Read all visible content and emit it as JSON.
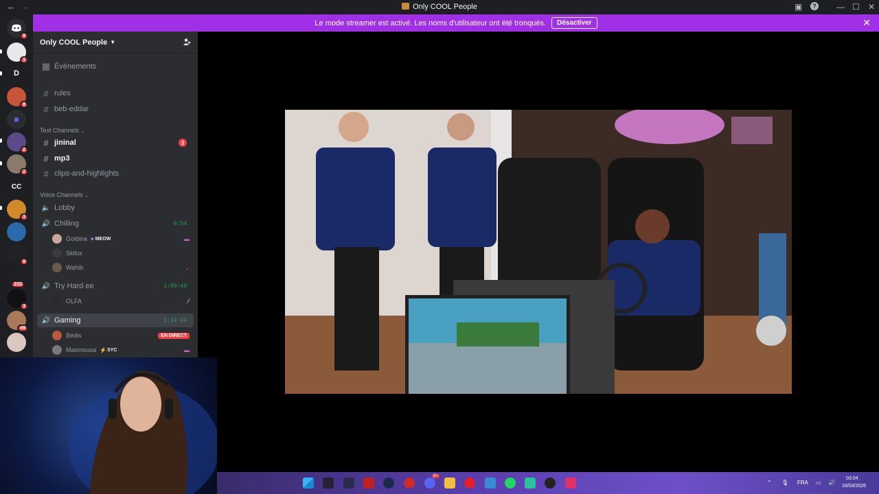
{
  "window": {
    "title": "Only COOL People"
  },
  "banner": {
    "text": "Le mode streamer est activé. Les noms d'utilisateur ont été tronqués.",
    "action": "Désactiver"
  },
  "servers": [
    {
      "name": "discord-home",
      "badge": "9"
    },
    {
      "name": "server-1",
      "badge": "3"
    },
    {
      "name": "server-d",
      "label": "D"
    },
    {
      "name": "server-2",
      "badge": "8"
    },
    {
      "name": "folder"
    },
    {
      "name": "server-3",
      "badge": "2"
    },
    {
      "name": "server-4",
      "badge": "2"
    },
    {
      "name": "server-cc",
      "label": "CC"
    },
    {
      "name": "server-5",
      "badge": "3"
    },
    {
      "name": "server-6"
    },
    {
      "name": "server-7",
      "badge": "9"
    },
    {
      "name": "server-8",
      "badge": "232"
    },
    {
      "name": "server-9",
      "badge": "3"
    },
    {
      "name": "server-10",
      "badge": "49"
    },
    {
      "name": "server-11"
    }
  ],
  "guild": {
    "name": "Only COOL People",
    "events": "Événements",
    "channels_top": [
      "rules",
      "beb-eddar"
    ],
    "text_category": "Text Channels",
    "text_channels": [
      {
        "name": "jininal",
        "badge": "3"
      },
      {
        "name": "mp3"
      },
      {
        "name": "clips-and-highlights"
      }
    ],
    "voice_category": "Voice Channels",
    "voice": {
      "lobby": "Lobby",
      "chilling": "Chilling",
      "chilling_time": "9:54",
      "chilling_users": [
        {
          "name": "Goldina",
          "tag": "MEOW"
        },
        {
          "name": "Skilox"
        },
        {
          "name": "Wahib"
        }
      ],
      "tryhard": "Try Hard ee",
      "tryhard_time": "1:09:40",
      "tryhard_users": [
        {
          "name": "OLFA"
        }
      ],
      "gaming": "Gaming",
      "gaming_time": "1:14:44",
      "gaming_users": [
        {
          "name": "Bédis",
          "live": "EN DIRECT"
        },
        {
          "name": "Masmousa",
          "tag": "SYC"
        }
      ]
    }
  },
  "taskbar": {
    "lang": "FRA",
    "time": "03:04",
    "date": "16/03/2026",
    "discord_badge": "9+"
  }
}
